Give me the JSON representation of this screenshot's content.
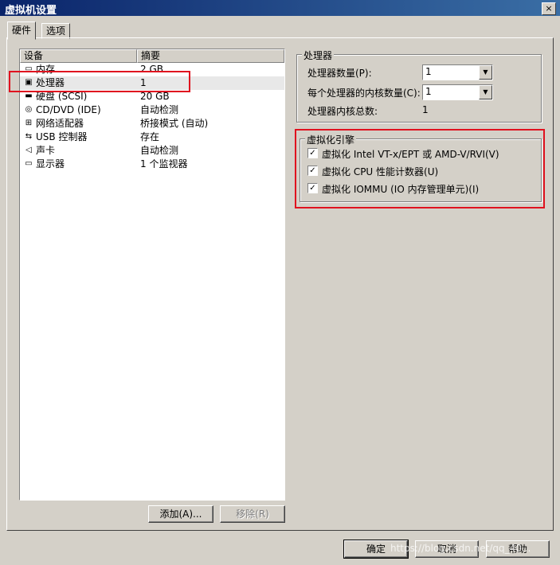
{
  "window": {
    "title": "虚拟机设置",
    "close_glyph": "×"
  },
  "tabs": [
    {
      "label": "硬件",
      "active": true
    },
    {
      "label": "选项",
      "active": false
    }
  ],
  "device_list": {
    "headers": {
      "device": "设备",
      "summary": "摘要"
    },
    "rows": [
      {
        "icon": "memory-icon",
        "name": "内存",
        "summary": "2 GB"
      },
      {
        "icon": "processor-icon",
        "name": "处理器",
        "summary": "1",
        "selected": true
      },
      {
        "icon": "hard-disk-icon",
        "name": "硬盘 (SCSI)",
        "summary": "20 GB"
      },
      {
        "icon": "cd-dvd-icon",
        "name": "CD/DVD (IDE)",
        "summary": "自动检测"
      },
      {
        "icon": "network-adapter-icon",
        "name": "网络适配器",
        "summary": "桥接模式 (自动)"
      },
      {
        "icon": "usb-controller-icon",
        "name": "USB 控制器",
        "summary": "存在"
      },
      {
        "icon": "sound-card-icon",
        "name": "声卡",
        "summary": "自动检测"
      },
      {
        "icon": "display-icon",
        "name": "显示器",
        "summary": "1 个监视器"
      }
    ],
    "add_button": "添加(A)...",
    "remove_button": "移除(R)"
  },
  "processor_group": {
    "title": "处理器",
    "num_processors_label": "处理器数量(P):",
    "num_processors_value": "1",
    "cores_per_processor_label": "每个处理器的内核数量(C):",
    "cores_per_processor_value": "1",
    "total_cores_label": "处理器内核总数:",
    "total_cores_value": "1"
  },
  "virtualization_group": {
    "title": "虚拟化引擎",
    "options": [
      {
        "label": "虚拟化 Intel VT-x/EPT 或 AMD-V/RVI(V)",
        "checked": true
      },
      {
        "label": "虚拟化 CPU 性能计数器(U)",
        "checked": true
      },
      {
        "label": "虚拟化 IOMMU (IO 内存管理单元)(I)",
        "checked": true
      }
    ]
  },
  "footer": {
    "ok_button": "确定",
    "cancel_button": "取消",
    "help_button": "帮助"
  },
  "watermark": "https://blog.csdn.net/qq_40...",
  "colors": {
    "highlight_box": "#e0121f",
    "titlebar": "#0a246a"
  }
}
